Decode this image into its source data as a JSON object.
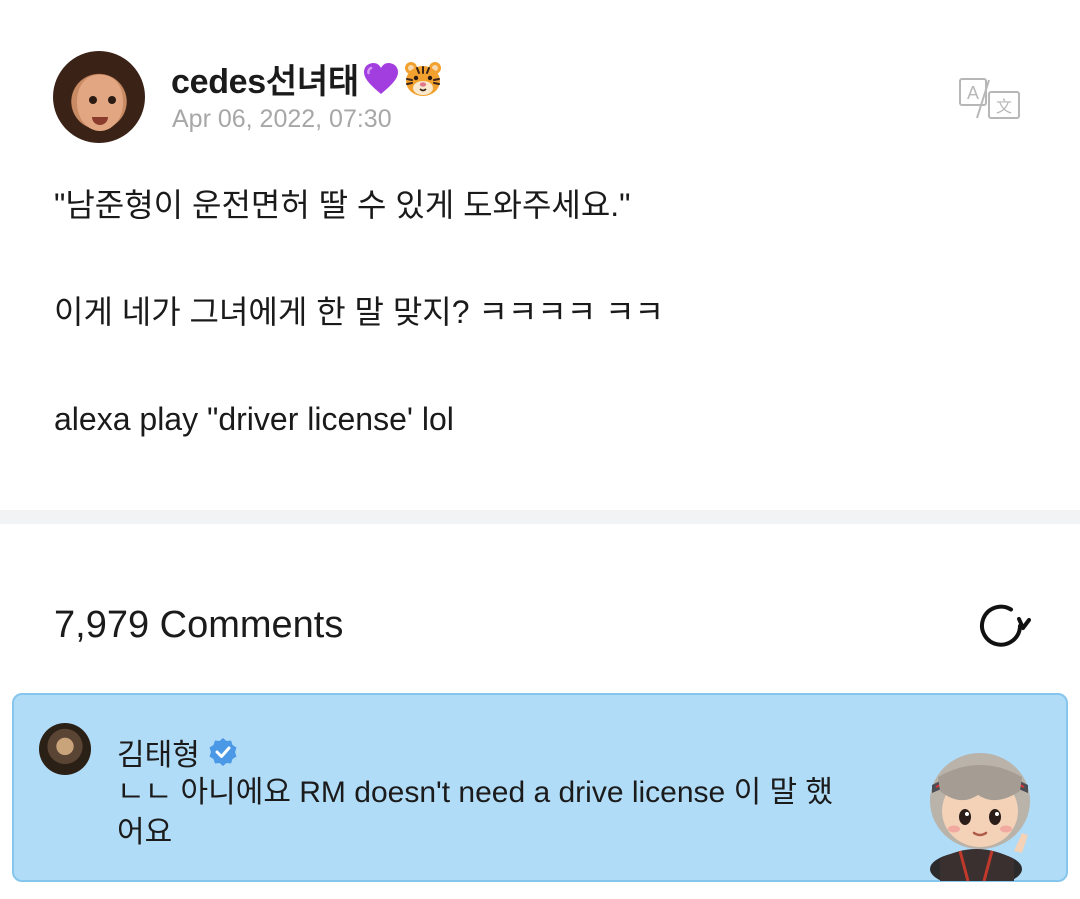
{
  "post": {
    "author": "cedes선녀태",
    "author_emojis": [
      "purple-heart-icon",
      "tiger-face-icon"
    ],
    "timestamp": "Apr 06, 2022, 07:30",
    "lines": [
      "\"남준형이 운전면허 딸 수 있게 도와주세요.\"",
      "이게 네가 그녀에게 한 말 맞지? ㅋㅋㅋㅋ ㅋㅋ",
      "alexa play \"driver license' lol"
    ]
  },
  "comments": {
    "header": "7,979 Comments",
    "items": [
      {
        "author": "김태형",
        "verified": true,
        "text": "ㄴㄴ 아니에요 RM doesn't need a drive license 이 말 했어요"
      }
    ]
  },
  "colors": {
    "comment_bg": "#b0dcf7",
    "comment_border": "#86c6ee",
    "verified": "#4a98e6",
    "timestamp": "#a7a7a7"
  }
}
